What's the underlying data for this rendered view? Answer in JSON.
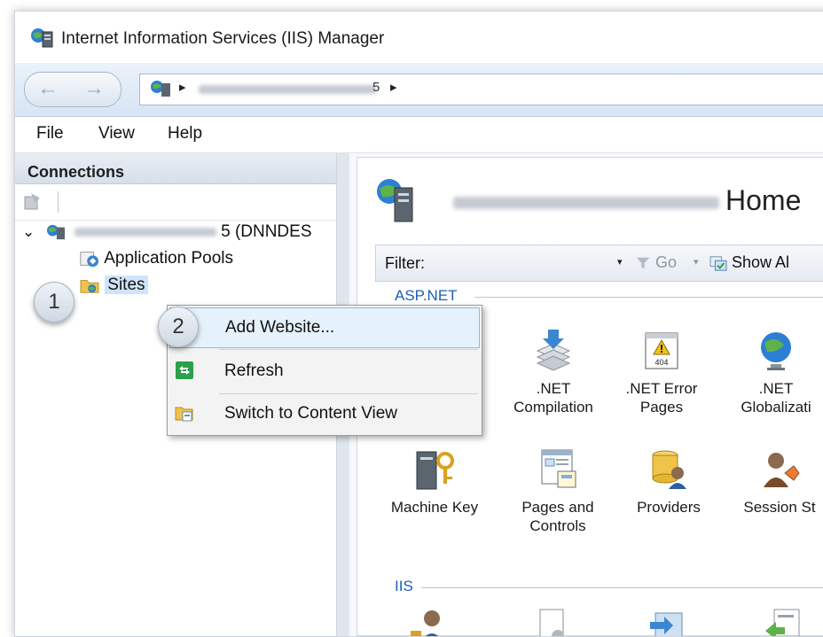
{
  "window": {
    "title": "Internet Information Services (IIS) Manager"
  },
  "address": {
    "fragment": "5",
    "chevron": "▸"
  },
  "nav": {
    "back": "←",
    "forward": "→"
  },
  "menu": {
    "items": [
      "File",
      "View",
      "Help"
    ]
  },
  "connections": {
    "title": "Connections",
    "tree": {
      "expander": "⌄",
      "server_suffix": "5 (DNNDES",
      "app_pools": "Application Pools",
      "sites": "Sites"
    }
  },
  "home": {
    "title": "Home",
    "filter_label": "Filter:",
    "filter_value": "",
    "go_label": "Go",
    "show_all_label": "Show Al",
    "dropdown_glyph": "▾"
  },
  "groups": {
    "aspnet": {
      "label": "ASP.NET",
      "features": [
        {
          "label1": ".NET",
          "label2": "Compilation",
          "icon": "compilation-icon"
        },
        {
          "label1": ".NET Error",
          "label2": "Pages",
          "icon": "error-pages-icon"
        },
        {
          "label1": ".NET",
          "label2": "Globalizati",
          "icon": "globalization-icon"
        },
        {
          "label1": "Machine Key",
          "label2": "",
          "icon": "machine-key-icon"
        },
        {
          "label1": "Pages and",
          "label2": "Controls",
          "icon": "pages-controls-icon"
        },
        {
          "label1": "Providers",
          "label2": "",
          "icon": "providers-icon"
        },
        {
          "label1": "Session St",
          "label2": "",
          "icon": "session-state-icon"
        }
      ]
    },
    "iis": {
      "label": "IIS"
    }
  },
  "context_menu": {
    "items": [
      {
        "label": "Add Website..."
      },
      {
        "label": "Refresh"
      },
      {
        "label": "Switch to Content View"
      }
    ]
  },
  "callouts": {
    "step1": "1",
    "step2": "2"
  },
  "icons": {
    "error_404_text": "404"
  },
  "colors": {
    "accent": "#1b5fb4",
    "selection": "#cfe4fb",
    "highlight": "#e5f1fb"
  }
}
